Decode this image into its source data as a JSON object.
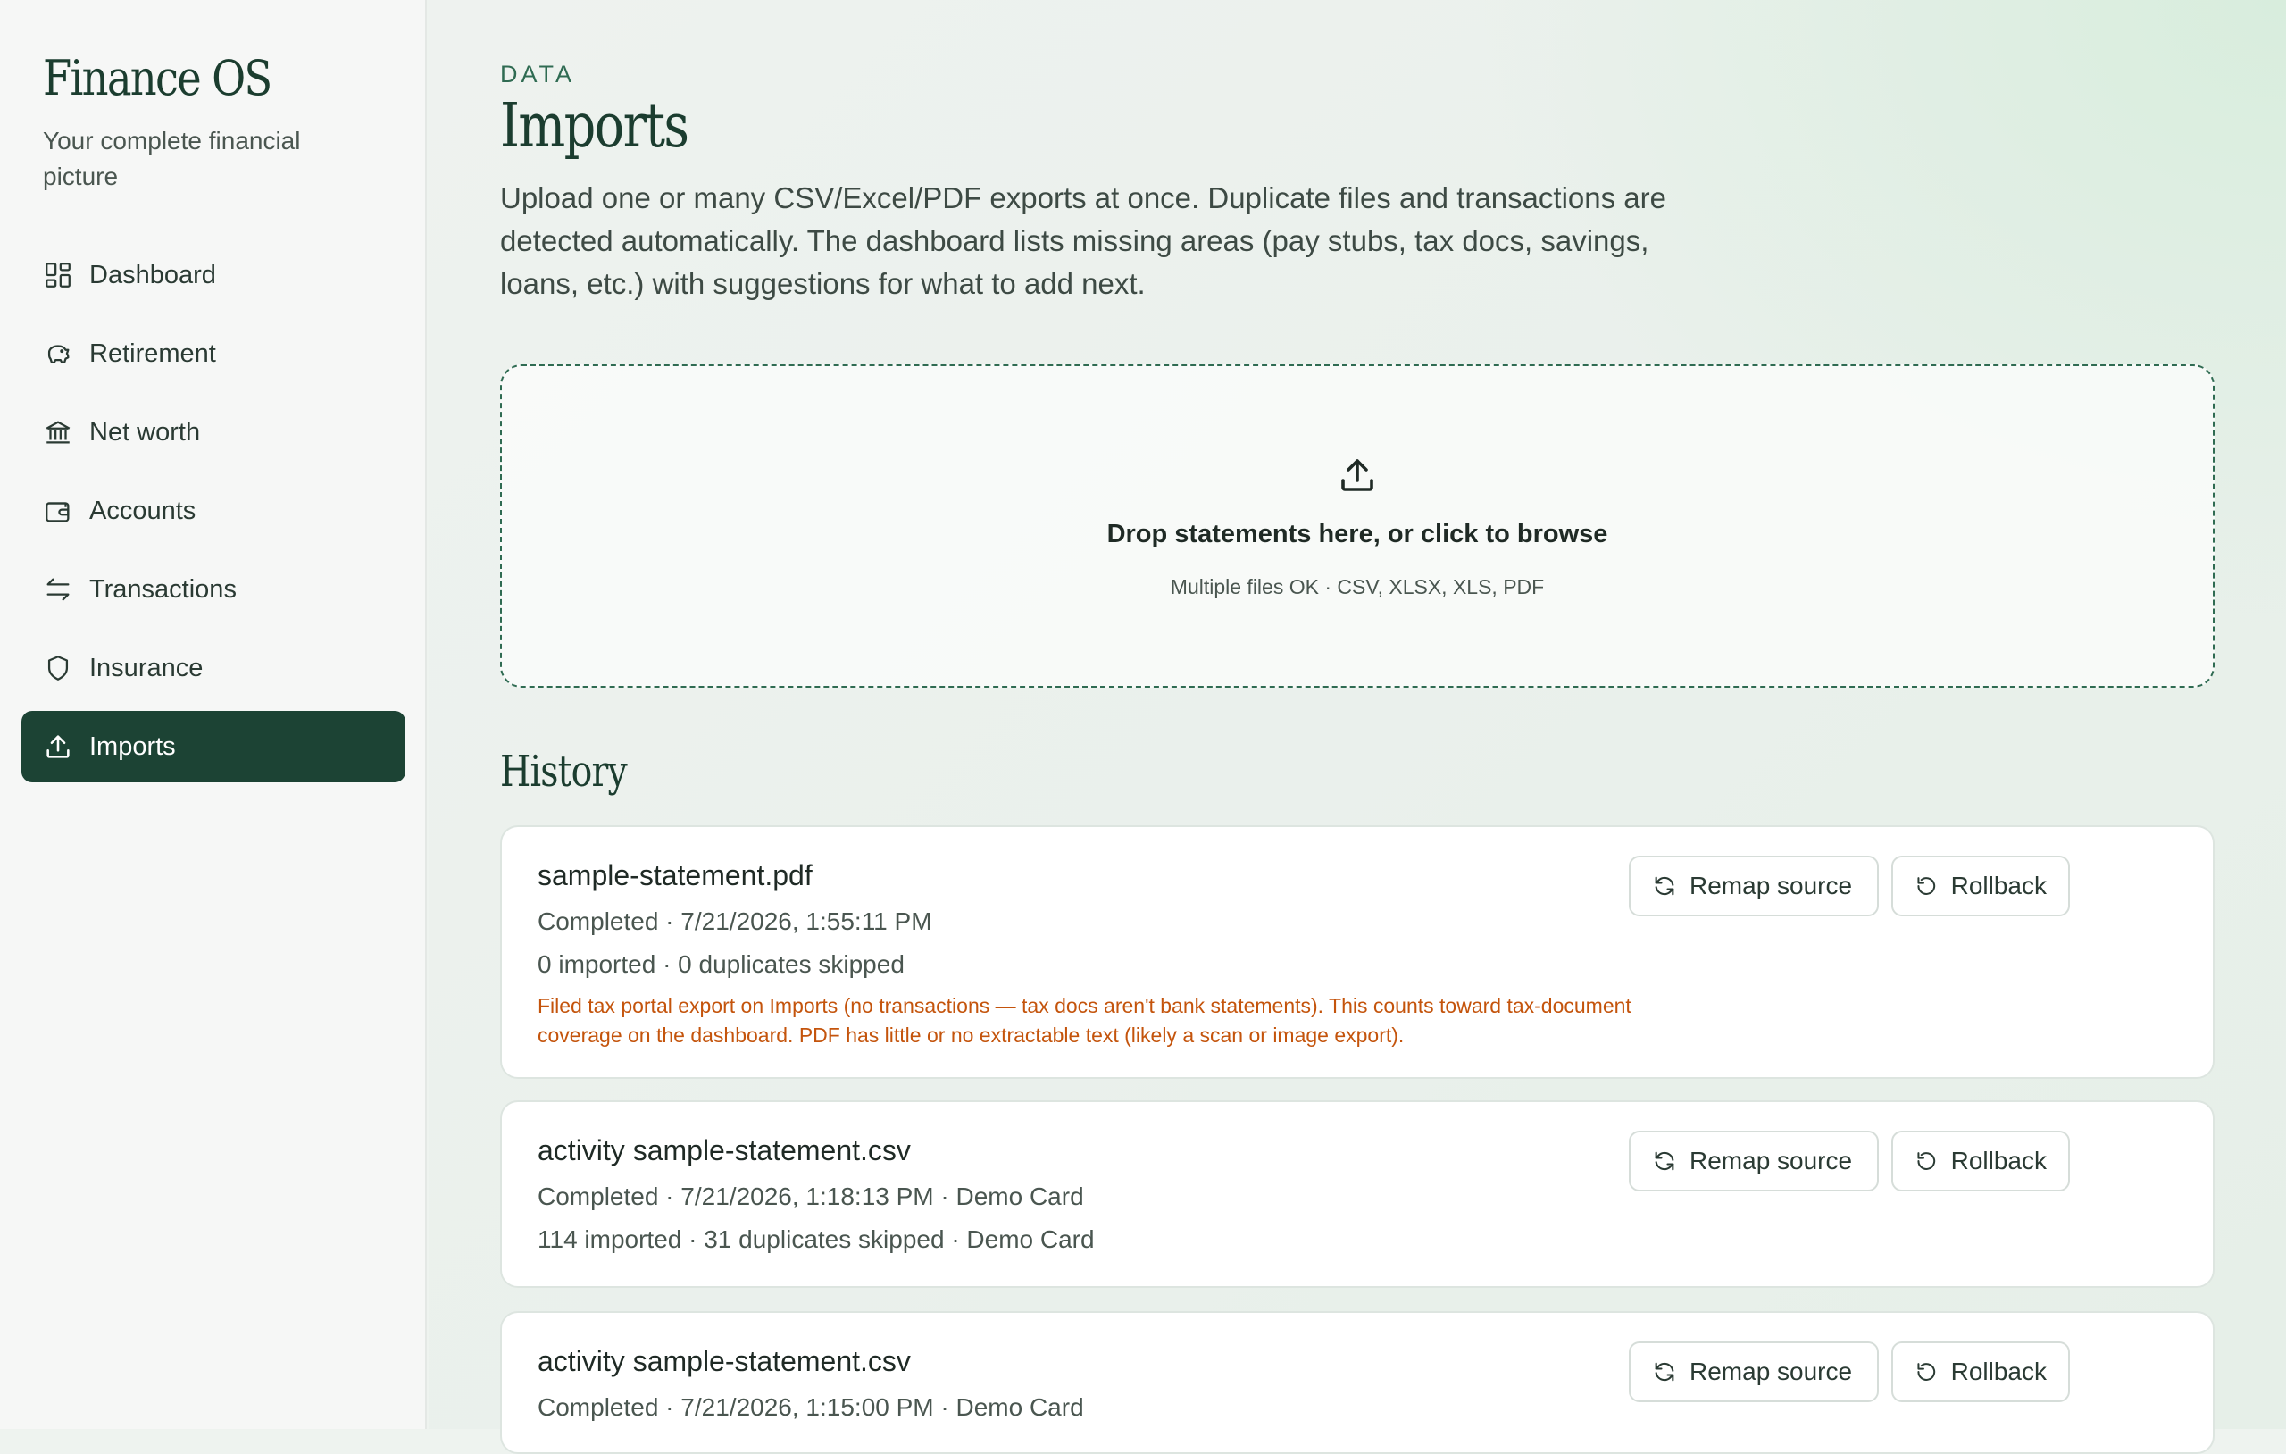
{
  "app": {
    "name": "Finance OS",
    "tagline": "Your complete financial picture"
  },
  "nav": {
    "items": [
      {
        "label": "Dashboard",
        "icon": "dashboard-icon"
      },
      {
        "label": "Retirement",
        "icon": "piggy-bank-icon"
      },
      {
        "label": "Net worth",
        "icon": "bank-icon"
      },
      {
        "label": "Accounts",
        "icon": "wallet-icon"
      },
      {
        "label": "Transactions",
        "icon": "arrows-left-right-icon"
      },
      {
        "label": "Insurance",
        "icon": "shield-icon"
      },
      {
        "label": "Imports",
        "icon": "upload-icon",
        "active": true
      }
    ]
  },
  "page": {
    "eyebrow": "DATA",
    "title": "Imports",
    "intro": "Upload one or many CSV/Excel/PDF exports at once. Duplicate files and transactions are detected automatically. The dashboard lists missing areas (pay stubs, tax docs, savings, loans, etc.) with suggestions for what to add next."
  },
  "dropzone": {
    "title": "Drop statements here, or click to browse",
    "subtitle": "Multiple files OK · CSV, XLSX, XLS, PDF",
    "icon": "upload-icon"
  },
  "history": {
    "title": "History",
    "remap_label": "Remap source",
    "rollback_label": "Rollback",
    "items": [
      {
        "file": "sample-statement.pdf",
        "status_line": "Completed · 7/21/2026, 1:55:11 PM",
        "counts_line": "0 imported · 0 duplicates skipped",
        "note": "Filed tax portal export on Imports (no transactions — tax docs aren't bank statements). This counts toward tax-document coverage on the dashboard. PDF has little or no extractable text (likely a scan or image export)."
      },
      {
        "file": "activity sample-statement.csv",
        "status_line": "Completed · 7/21/2026, 1:18:13 PM · Demo Card",
        "counts_line": "114 imported · 31 duplicates skipped · Demo Card"
      },
      {
        "file": "activity sample-statement.csv",
        "status_line": "Completed · 7/21/2026, 1:15:00 PM · Demo Card"
      }
    ]
  },
  "colors": {
    "accent": "#1c4334",
    "warning": "#c4540c",
    "brand_text": "#1b3d2f"
  }
}
